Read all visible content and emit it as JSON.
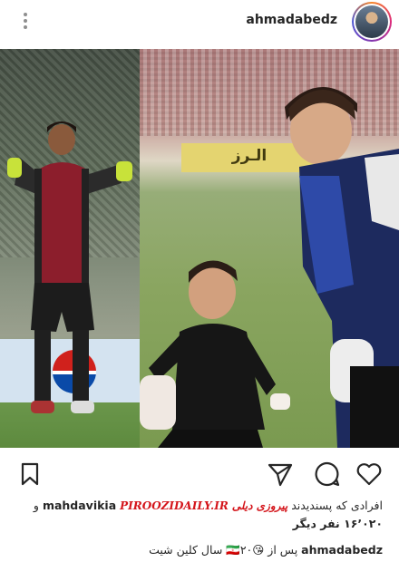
{
  "header": {
    "username": "ahmadabedz",
    "menu_icon": "more-vertical-icon"
  },
  "post": {
    "banner_text": "الـرز"
  },
  "actions": {
    "icons": [
      "bookmark-icon",
      "share-icon",
      "comment-icon",
      "heart-icon"
    ]
  },
  "likes": {
    "prefix": "افرادی که پسندیدند",
    "liked_by": "mahdavikia",
    "watermark": "PIROOZIDAILY.IR",
    "watermark_fa": "پیروزی دیلی",
    "and": "و",
    "count_line": "۱۶٬۰۲۰ نفر دیگر"
  },
  "caption": {
    "username": "ahmadabedz",
    "text": "پس از 😘🇮🇷۲۰ سال کلین شیت"
  }
}
